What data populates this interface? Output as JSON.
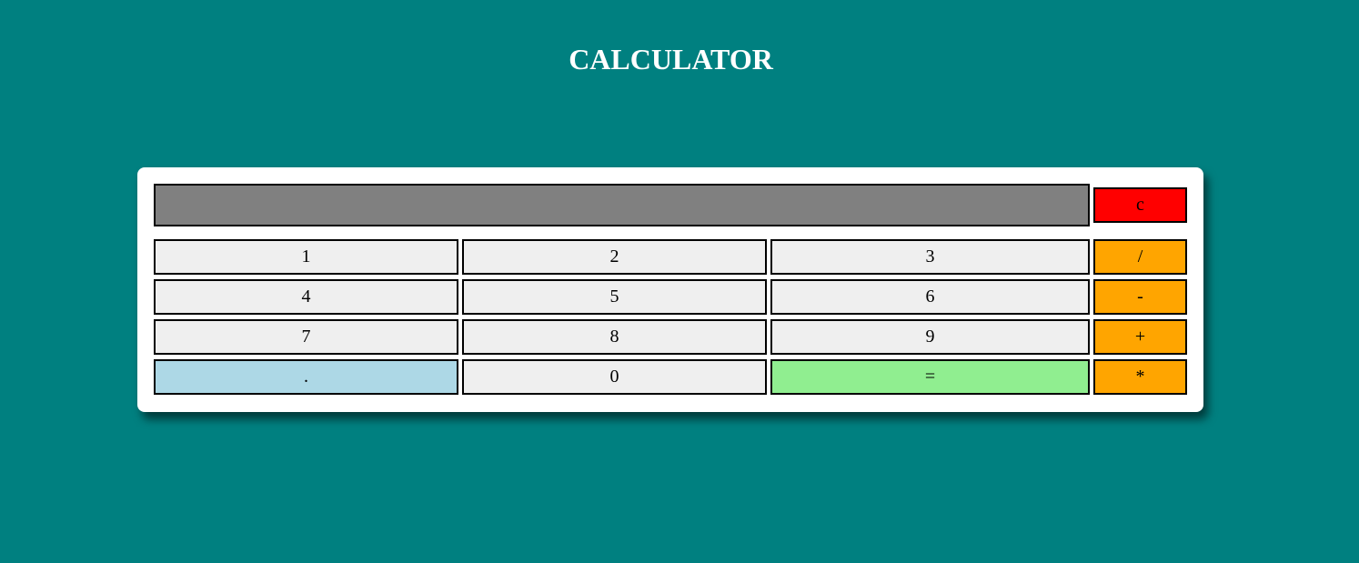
{
  "header": {
    "title": "CALCULATOR"
  },
  "display": {
    "value": ""
  },
  "keys": {
    "clear": "c",
    "one": "1",
    "two": "2",
    "three": "3",
    "divide": "/",
    "four": "4",
    "five": "5",
    "six": "6",
    "subtract": "-",
    "seven": "7",
    "eight": "8",
    "nine": "9",
    "add": "+",
    "decimal": ".",
    "zero": "0",
    "equals": "=",
    "multiply": "*"
  },
  "colors": {
    "background": "#008080",
    "panel": "#ffffff",
    "display": "#808080",
    "number_key": "#efefef",
    "operator_key": "#ffa500",
    "clear_key": "#ff0000",
    "decimal_key": "#add8e6",
    "equals_key": "#90ee90"
  }
}
